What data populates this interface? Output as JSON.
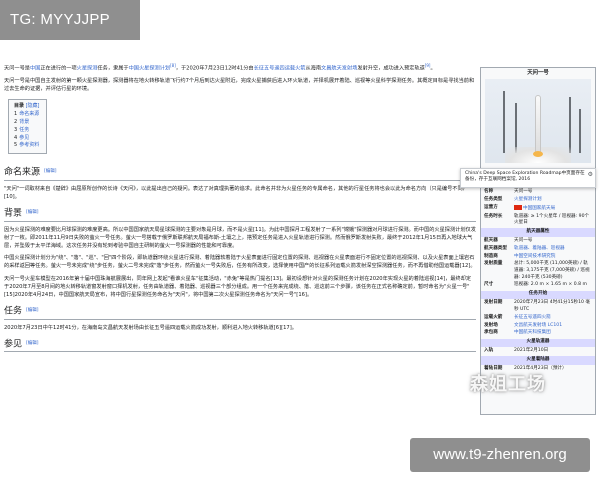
{
  "overlay": {
    "tg_badge": "TG: MYYJJPP",
    "url_badge": "www.t9-zhenren.org",
    "watermark": "森姐工场"
  },
  "article": {
    "intro_p1_a": "天问一号是",
    "intro_p1_link1": "中国",
    "intro_p1_b": "正在进行的一项",
    "intro_p1_link2": "火星探测",
    "intro_p1_c": "任务，隶属于",
    "intro_p1_link3": "中国火星探测计划",
    "intro_p1_sup": "[8]",
    "intro_p1_d": "，于2020年7月23日12时41分由",
    "intro_p1_link4": "长征五号遥四运载火箭",
    "intro_p1_e": "从海南",
    "intro_p1_link5": "文昌航天发射场",
    "intro_p1_f": "发射升空，成功进入预定轨道",
    "intro_p1_sup2": "[9]",
    "intro_p1_g": "。",
    "intro_p2": "天问一号是中国自主发射的第一颗火星探测器，探测器将在地火转移轨道飞行约7个月后到达火星附近，完成火星捕获后进入环火轨道，并择机展开着陆、巡视等火星科学探测任务。其概定目标是寻找当前和过去生命的证据，并评估行星的环境。",
    "toc": {
      "title": "目录",
      "toggle": "[隐藏]",
      "items": [
        {
          "num": "1",
          "label": "命名来源"
        },
        {
          "num": "2",
          "label": "背景"
        },
        {
          "num": "3",
          "label": "任务"
        },
        {
          "num": "4",
          "label": "参见"
        },
        {
          "num": "5",
          "label": "参考资料"
        }
      ]
    },
    "edit_label": "[编辑]",
    "sec1_title": "命名来源",
    "sec1_text": "\"天问\"一词取材来自《楚辞》由屈原所创作的长诗《天问》，以此提出自己的疑问。表达了对真理执著的追求。此命名并非为火星任务的专属命名，其他的行星任务将也会以此为命名方向（只是编号不同）[10]。",
    "sec2_title": "背景",
    "sec2_p1": "因为火星探测的难度要比月球探测的难度更高。所以中国国家航天局星球探测的主要对象是月球，而不是火星[11]。为此中国探月工程发射了一系列\"嫦娥\"探测器对月球进行探测。而中国的火星探测计划仅发射了一枚。即2011年11月9日失败的萤火一号任务。萤火一号搭载于俄罗斯联邦航天局福布斯-土壤之上，搭预定任务是进入火星轨道进行探测。然而俄罗斯发射失败，最终于2012年1月15日再入地球大气层，并坠毁于太平洋海域。这次任务并没有轮到考验中国自主研制的萤火一号探测器的性能和可靠度。",
    "sec2_p2": "中国火星探测计划分为\"绕\"、\"落\"、\"巡\"、\"回\"四个阶段，即轨道器环绕火星进行探测、着陆器软着陆于火星表面进行固定位置的探测、巡视器在火星表面进行不固定位置的巡视探测、以及火星表面上壤岩石的采样返回等任务。萤火一号未完成\"绕\"步任务，萤火二号未完成\"落\"步任务，然而萤火一号失败后，任务有所改变，选择使用中国产的长征系列运载火箭发射深空探测器任务，而不再借助他国运载器[12]。",
    "sec2_p3": "天问一号火星车模型在2016年第十届中国珠海航展展出，同年网上发起\"看谁火星车\"征集活动，\"赤兔\"等是热门提名[13]。最初设想针对火星的探测任务计划在2020年实现火星的着陆巡视[14]，最终却定于2020年7月至8月间的地火转移轨道窗发射窗口择机发射，任务由轨道器、着陆器、巡视器三个部分组成。用一个任务来完成绕、落、巡这前三个步骤，该任务在正式名称确定前，暂时命名为\"火星一号\"[15]2020年4月24日，中国国家航天局宣布，将中国行星探测任务命名为\"天问\"，将中国第二次火星探测任务命名为\"天问一号\"[16]。",
    "sec3_title": "任务",
    "sec3_text": "2020年7月23日中午12时41分，在海南岛文昌航天发射场由长征五号遥四运载火箭成功发射，顺利进入地火转移轨道[6][17]。",
    "sec4_title": "参见"
  },
  "infobox": {
    "title": "天问一号",
    "image_caption": "China's Deep Space Exploration Roadmap中页面存在备份，存于互联网档案馆, 2016",
    "name_key": "名称",
    "name_val": "天问一号",
    "rows_top": [
      {
        "key": "任务类型",
        "val": "火星探测计划"
      },
      {
        "key": "运营方",
        "val": "中国国家航天局"
      },
      {
        "key": "任务时长",
        "val": "轨道器: ≥ 1个火星年 / 巡视器: 90个火星日"
      }
    ],
    "head_spacecraft": "航天器属性",
    "rows_spacecraft": [
      {
        "key": "航天器",
        "val": "天问一号"
      },
      {
        "key": "航天器类型",
        "val": "轨道器、着陆器、巡视器"
      },
      {
        "key": "制造商",
        "val": "中国空间技术研究院"
      },
      {
        "key": "发射质量",
        "val": "总计: 5,000千克 (11,000英磅) / 轨道器: 3,175千克 (7,000英磅) / 巡视器: 240千克 (530英磅)"
      },
      {
        "key": "尺寸",
        "val": "巡视器: 2.0 m × 1.65 m × 0.8 m"
      }
    ],
    "head_mission": "任务开始",
    "rows_mission": [
      {
        "key": "发射日期",
        "val": "2020年7月23日 4时41分15秒10 毫秒 UTC"
      },
      {
        "key": "运载火箭",
        "val": "长征五号遥四火箭"
      },
      {
        "key": "发射场",
        "val": "文昌航天发射场 LC101"
      },
      {
        "key": "承包商",
        "val": "中国航天科技集团"
      }
    ],
    "head_orbit": "火星轨道器",
    "rows_orbit": [
      {
        "key": "入轨",
        "val": "2021年2月10日"
      }
    ],
    "head_lander": "火星着陆器",
    "rows_lander": [
      {
        "key": "着陆日期",
        "val": "2021年4月23日（预计）"
      }
    ]
  }
}
